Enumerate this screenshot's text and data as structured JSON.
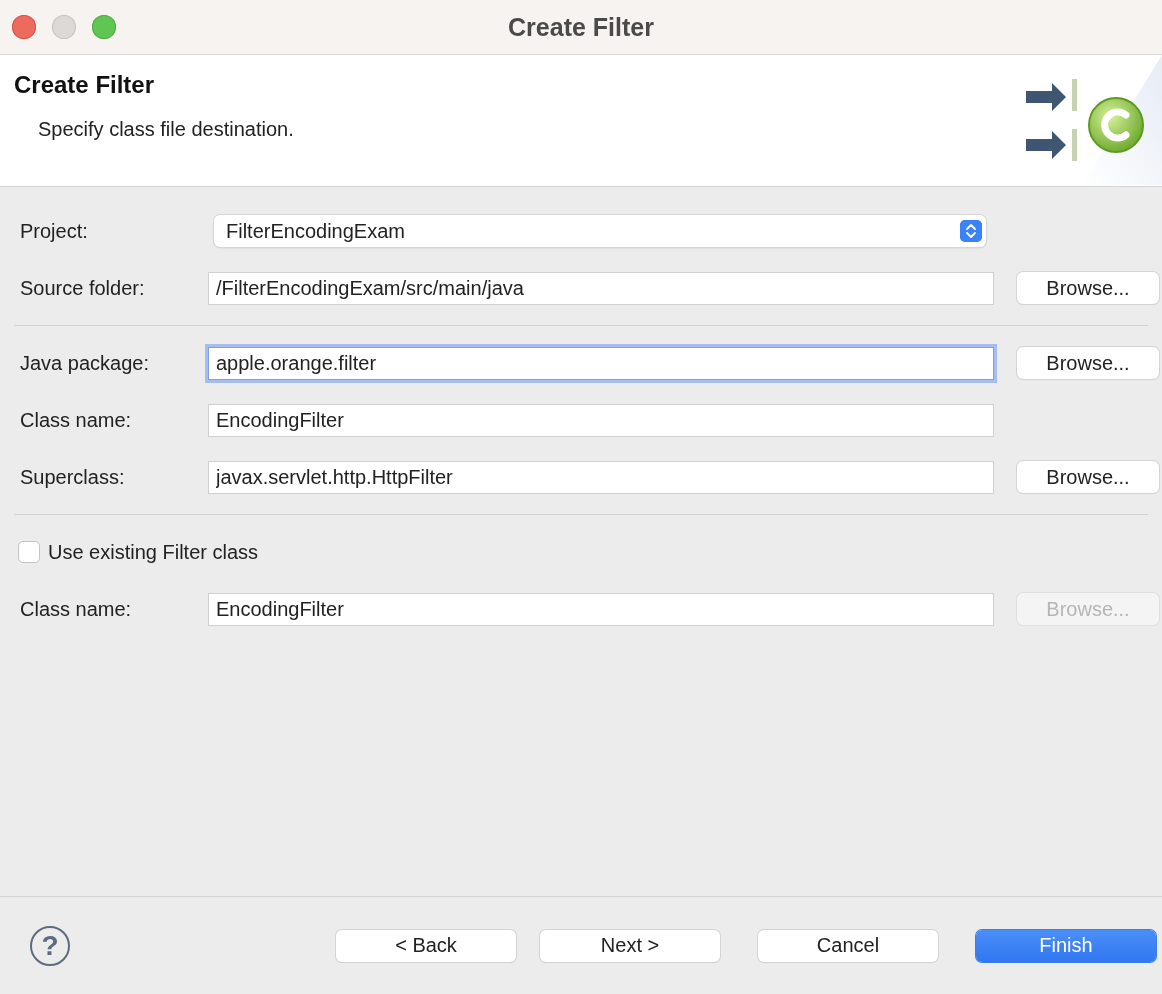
{
  "window": {
    "title": "Create Filter"
  },
  "header": {
    "title": "Create Filter",
    "description": "Specify class file destination."
  },
  "groups": [
    {
      "rows": [
        {
          "kind": "select",
          "label": "Project:",
          "value": "FilterEncodingExam"
        },
        {
          "kind": "text",
          "label": "Source folder:",
          "value": "/FilterEncodingExam/src/main/java",
          "focused": false,
          "browse": {
            "label": "Browse...",
            "disabled": false
          }
        }
      ]
    },
    {
      "rows": [
        {
          "kind": "text",
          "label": "Java package:",
          "value": "apple.orange.filter",
          "focused": true,
          "browse": {
            "label": "Browse...",
            "disabled": false
          }
        },
        {
          "kind": "text",
          "label": "Class name:",
          "value": "EncodingFilter",
          "focused": false
        },
        {
          "kind": "text",
          "label": "Superclass:",
          "value": "javax.servlet.http.HttpFilter",
          "focused": false,
          "browse": {
            "label": "Browse...",
            "disabled": false
          }
        }
      ]
    },
    {
      "rows": [
        {
          "kind": "checkbox",
          "label": "Use existing Filter class",
          "checked": false
        },
        {
          "kind": "text",
          "label": "Class name:",
          "value": "EncodingFilter",
          "focused": false,
          "browse": {
            "label": "Browse...",
            "disabled": true
          }
        }
      ]
    }
  ],
  "footer": {
    "help": "?",
    "buttons": [
      {
        "label": "< Back",
        "kind": "normal"
      },
      {
        "label": "Next >",
        "kind": "normal"
      },
      {
        "label": "Cancel",
        "kind": "normal"
      },
      {
        "label": "Finish",
        "kind": "default"
      }
    ]
  }
}
